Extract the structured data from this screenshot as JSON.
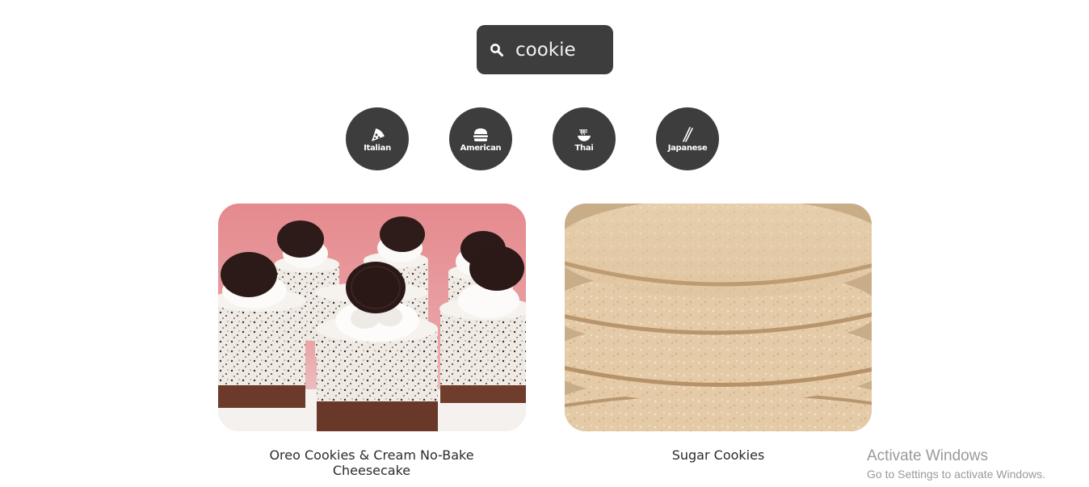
{
  "search": {
    "value": "cookie",
    "placeholder": "",
    "icon": "search-icon"
  },
  "categories": [
    {
      "label": "Italian",
      "icon": "pizza-icon"
    },
    {
      "label": "American",
      "icon": "burger-icon"
    },
    {
      "label": "Thai",
      "icon": "noodle-bowl-icon"
    },
    {
      "label": "Japanese",
      "icon": "chopsticks-icon"
    }
  ],
  "recipes": [
    {
      "title": "Oreo Cookies & Cream No-Bake Cheesecake",
      "image": "oreo-cheesecake-photo"
    },
    {
      "title": "Sugar Cookies",
      "image": "sugar-cookies-photo"
    }
  ],
  "watermark": {
    "title": "Activate Windows",
    "subtitle": "Go to Settings to activate Windows."
  },
  "colors": {
    "button_dark": "#3d3d3d",
    "text": "#2b2b2b",
    "watermark": "#9a9a9a"
  }
}
